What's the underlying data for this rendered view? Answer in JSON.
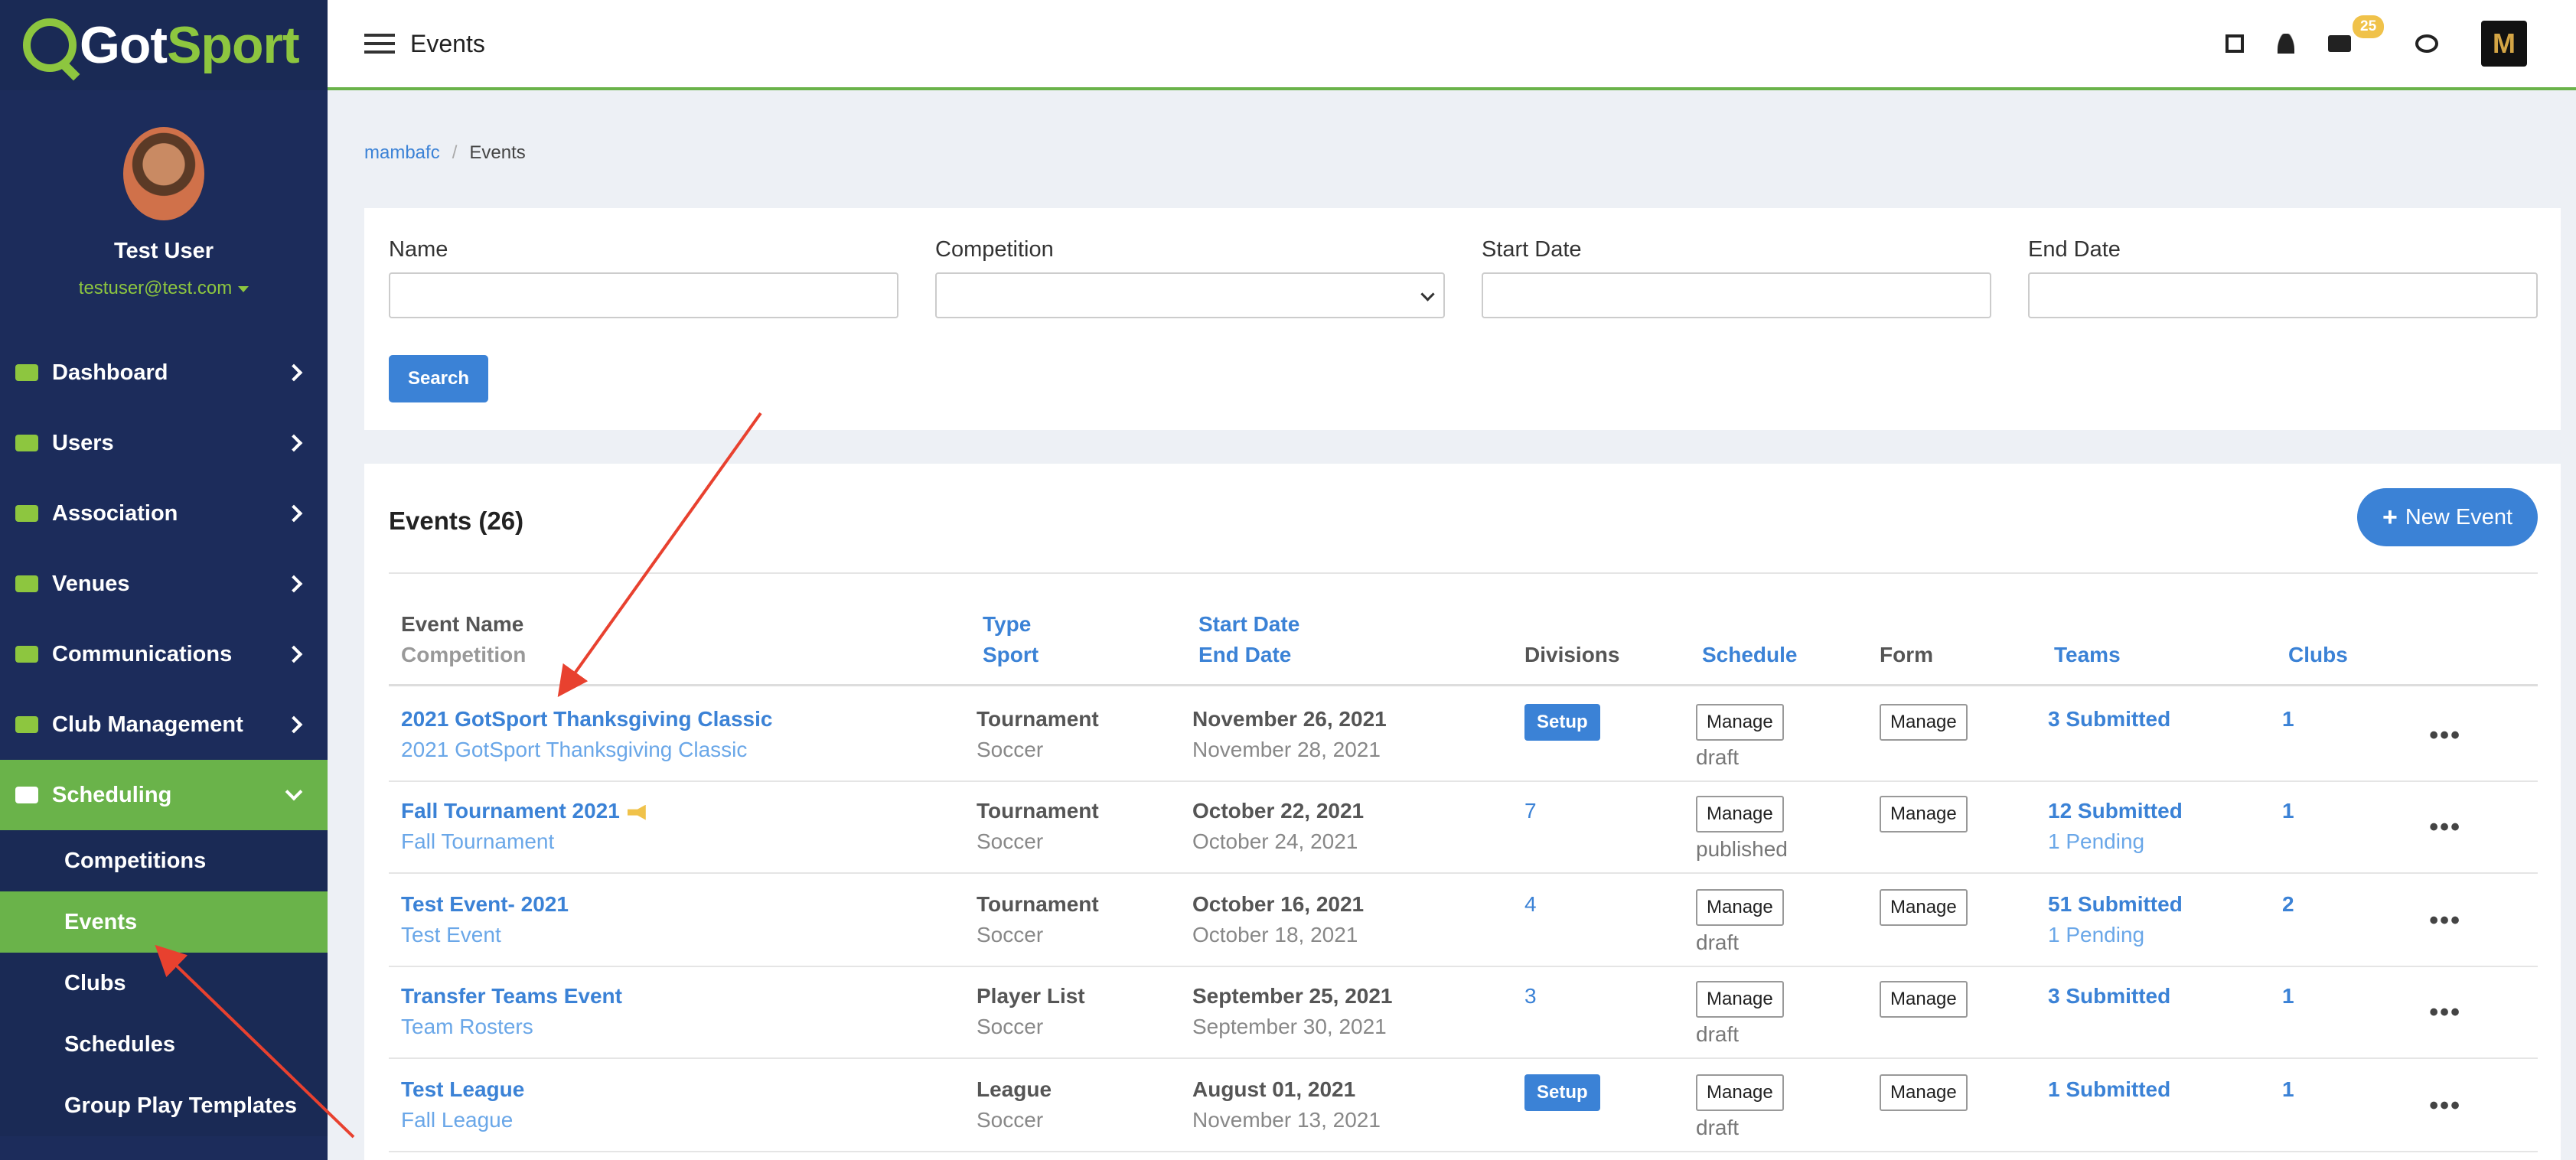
{
  "brand": {
    "logo_prefix": "Got",
    "logo_suffix": "Sport",
    "logo_mark_color": "#8dc63f"
  },
  "profile": {
    "name": "Test User",
    "email": "testuser@test.com"
  },
  "sidebar": {
    "items": [
      {
        "label": "Dashboard",
        "icon": "dashboard-icon"
      },
      {
        "label": "Users",
        "icon": "users-icon"
      },
      {
        "label": "Association",
        "icon": "sitemap-icon"
      },
      {
        "label": "Venues",
        "icon": "home-icon"
      },
      {
        "label": "Communications",
        "icon": "chat-icon"
      },
      {
        "label": "Club Management",
        "icon": "list-icon"
      },
      {
        "label": "Scheduling",
        "icon": "calendar-icon",
        "active": true
      }
    ],
    "sub_items": [
      {
        "label": "Competitions"
      },
      {
        "label": "Events",
        "active": true
      },
      {
        "label": "Clubs"
      },
      {
        "label": "Schedules"
      },
      {
        "label": "Group Play Templates"
      }
    ]
  },
  "topbar": {
    "title": "Events",
    "icons": [
      "qr-code-icon",
      "user-icon",
      "mail-icon",
      "comments-icon"
    ],
    "mail_badge": "25",
    "brand_initial": "M"
  },
  "breadcrumb": {
    "root": "mambafc",
    "current": "Events"
  },
  "filters": {
    "name_label": "Name",
    "competition_label": "Competition",
    "start_date_label": "Start Date",
    "end_date_label": "End Date",
    "search_button": "Search"
  },
  "events": {
    "title": "Events (26)",
    "new_button": "New Event",
    "headers": {
      "event_name": "Event Name",
      "competition": "Competition",
      "type": "Type",
      "sport": "Sport",
      "start_date": "Start Date",
      "end_date": "End Date",
      "divisions": "Divisions",
      "schedule": "Schedule",
      "form": "Form",
      "teams": "Teams",
      "clubs": "Clubs"
    },
    "rows": [
      {
        "name": "2021 GotSport Thanksgiving Classic",
        "competition": "2021 GotSport Thanksgiving Classic",
        "type": "Tournament",
        "sport": "Soccer",
        "start": "November 26, 2021",
        "end": "November 28, 2021",
        "divisions": "Setup",
        "divisions_is_button": true,
        "schedule_btn": "Manage",
        "schedule_status": "draft",
        "form_btn": "Manage",
        "teams": "3 Submitted",
        "pending": "",
        "clubs": "1",
        "megaphone": false
      },
      {
        "name": "Fall Tournament 2021",
        "competition": "Fall Tournament",
        "type": "Tournament",
        "sport": "Soccer",
        "start": "October 22, 2021",
        "end": "October 24, 2021",
        "divisions": "7",
        "divisions_is_button": false,
        "schedule_btn": "Manage",
        "schedule_status": "published",
        "form_btn": "Manage",
        "teams": "12 Submitted",
        "pending": "1 Pending",
        "clubs": "1",
        "megaphone": true
      },
      {
        "name": "Test Event- 2021",
        "competition": "Test Event",
        "type": "Tournament",
        "sport": "Soccer",
        "start": "October 16, 2021",
        "end": "October 18, 2021",
        "divisions": "4",
        "divisions_is_button": false,
        "schedule_btn": "Manage",
        "schedule_status": "draft",
        "form_btn": "Manage",
        "teams": "51 Submitted",
        "pending": "1 Pending",
        "clubs": "2",
        "megaphone": false
      },
      {
        "name": "Transfer Teams Event",
        "competition": "Team Rosters",
        "type": "Player List",
        "sport": "Soccer",
        "start": "September 25, 2021",
        "end": "September 30, 2021",
        "divisions": "3",
        "divisions_is_button": false,
        "schedule_btn": "Manage",
        "schedule_status": "draft",
        "form_btn": "Manage",
        "teams": "3 Submitted",
        "pending": "",
        "clubs": "1",
        "megaphone": false
      },
      {
        "name": "Test League",
        "competition": "Fall League",
        "type": "League",
        "sport": "Soccer",
        "start": "August 01, 2021",
        "end": "November 13, 2021",
        "divisions": "Setup",
        "divisions_is_button": true,
        "schedule_btn": "Manage",
        "schedule_status": "draft",
        "form_btn": "Manage",
        "teams": "1 Submitted",
        "pending": "",
        "clubs": "1",
        "megaphone": false
      }
    ]
  },
  "colors": {
    "sidebar": "#1c2c5b",
    "accent_green": "#6ab34a",
    "link_blue": "#3b82d6",
    "arrow_red": "#e8412f"
  }
}
